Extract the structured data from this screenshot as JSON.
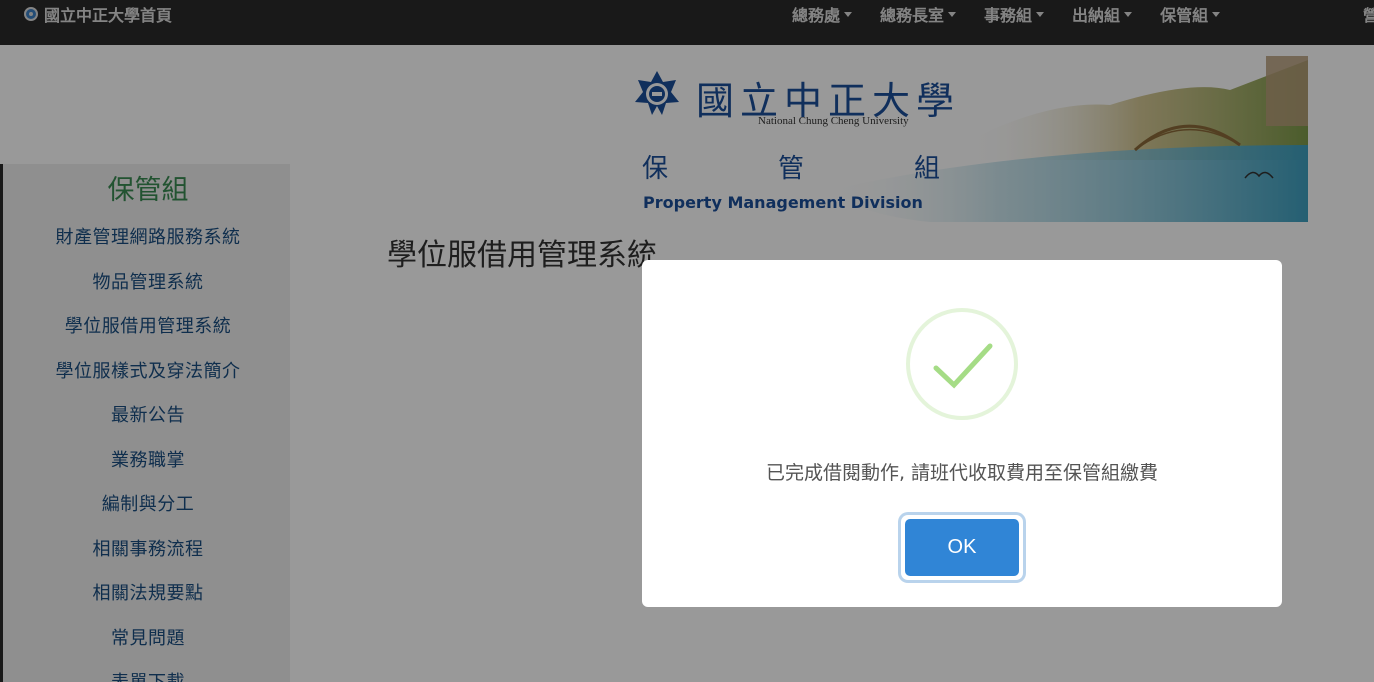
{
  "navbar": {
    "brand": "國立中正大學首頁",
    "menu": [
      {
        "label": "總務處"
      },
      {
        "label": "總務長室"
      },
      {
        "label": "事務組"
      },
      {
        "label": "出納組"
      },
      {
        "label": "保管組"
      }
    ],
    "cut_item": "營"
  },
  "banner": {
    "university_zh": "國立中正大學",
    "university_en": "National Chung Cheng University",
    "division_zh": [
      "保",
      "管",
      "組"
    ],
    "division_en": "Property Management Division"
  },
  "sidebar": {
    "title": "保管組",
    "items": [
      {
        "label": "財產管理網路服務系統"
      },
      {
        "label": "物品管理系統"
      },
      {
        "label": "學位服借用管理系統"
      },
      {
        "label": "學位服樣式及穿法簡介"
      },
      {
        "label": "最新公告"
      },
      {
        "label": "業務職掌"
      },
      {
        "label": "編制與分工"
      },
      {
        "label": "相關事務流程"
      },
      {
        "label": "相關法規要點"
      },
      {
        "label": "常見問題"
      },
      {
        "label": "表單下載"
      }
    ]
  },
  "main": {
    "heading": "學位服借用管理系統"
  },
  "modal": {
    "icon": "success-check-icon",
    "message": "已完成借閱動作, 請班代收取費用至保管組繳費",
    "ok_label": "OK"
  },
  "colors": {
    "navbar_bg": "#2b2b2b",
    "sidebar_title": "#3a8a52",
    "sidebar_link": "#1a4e80",
    "brand_blue": "#1c4f9a",
    "ok_button": "#3085d6",
    "success_green": "#a5dc86"
  }
}
